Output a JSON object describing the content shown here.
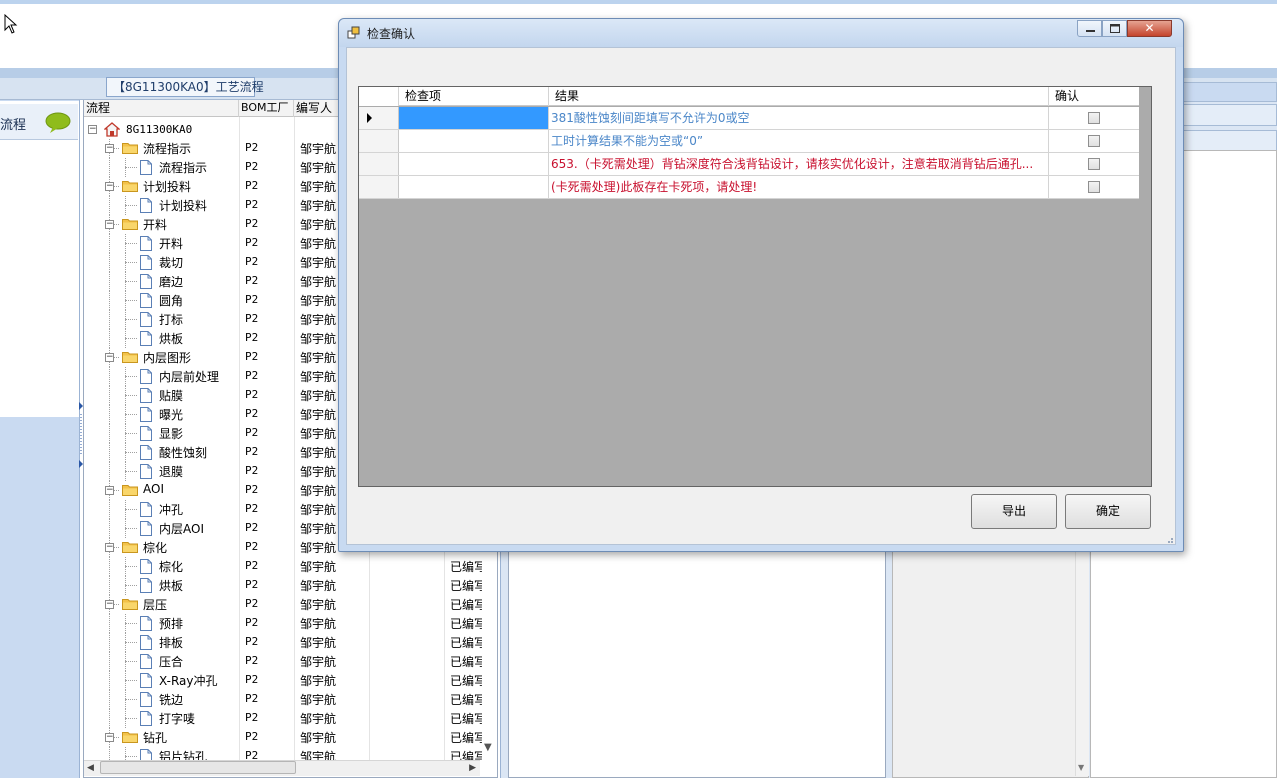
{
  "background_app": {
    "process_tab_label": "【8G11300KA0】工艺流程",
    "left_nav": {
      "item_label": "流程",
      "icon": "speech-bubble-icon"
    },
    "tree_grid": {
      "columns": [
        "流程",
        "BOM工厂",
        "编写人"
      ],
      "root_label": "8G11300KA0",
      "rows": [
        {
          "level": 1,
          "type": "folder",
          "label": "流程指示",
          "bom": "P2",
          "author": "邹宇航",
          "status": ""
        },
        {
          "level": 2,
          "type": "doc",
          "label": "流程指示",
          "bom": "P2",
          "author": "邹宇航",
          "status": ""
        },
        {
          "level": 1,
          "type": "folder",
          "label": "计划投料",
          "bom": "P2",
          "author": "邹宇航",
          "status": ""
        },
        {
          "level": 2,
          "type": "doc",
          "label": "计划投料",
          "bom": "P2",
          "author": "邹宇航",
          "status": ""
        },
        {
          "level": 1,
          "type": "folder",
          "label": "开料",
          "bom": "P2",
          "author": "邹宇航",
          "status": ""
        },
        {
          "level": 2,
          "type": "doc",
          "label": "开料",
          "bom": "P2",
          "author": "邹宇航",
          "status": ""
        },
        {
          "level": 2,
          "type": "doc",
          "label": "裁切",
          "bom": "P2",
          "author": "邹宇航",
          "status": ""
        },
        {
          "level": 2,
          "type": "doc",
          "label": "磨边",
          "bom": "P2",
          "author": "邹宇航",
          "status": ""
        },
        {
          "level": 2,
          "type": "doc",
          "label": "圆角",
          "bom": "P2",
          "author": "邹宇航",
          "status": ""
        },
        {
          "level": 2,
          "type": "doc",
          "label": "打标",
          "bom": "P2",
          "author": "邹宇航",
          "status": ""
        },
        {
          "level": 2,
          "type": "doc",
          "label": "烘板",
          "bom": "P2",
          "author": "邹宇航",
          "status": ""
        },
        {
          "level": 1,
          "type": "folder",
          "label": "内层图形",
          "bom": "P2",
          "author": "邹宇航",
          "status": ""
        },
        {
          "level": 2,
          "type": "doc",
          "label": "内层前处理",
          "bom": "P2",
          "author": "邹宇航",
          "status": ""
        },
        {
          "level": 2,
          "type": "doc",
          "label": "贴膜",
          "bom": "P2",
          "author": "邹宇航",
          "status": ""
        },
        {
          "level": 2,
          "type": "doc",
          "label": "曝光",
          "bom": "P2",
          "author": "邹宇航",
          "status": ""
        },
        {
          "level": 2,
          "type": "doc",
          "label": "显影",
          "bom": "P2",
          "author": "邹宇航",
          "status": ""
        },
        {
          "level": 2,
          "type": "doc",
          "label": "酸性蚀刻",
          "bom": "P2",
          "author": "邹宇航",
          "status": ""
        },
        {
          "level": 2,
          "type": "doc",
          "label": "退膜",
          "bom": "P2",
          "author": "邹宇航",
          "status": ""
        },
        {
          "level": 1,
          "type": "folder",
          "label": "AOI",
          "bom": "P2",
          "author": "邹宇航",
          "status": ""
        },
        {
          "level": 2,
          "type": "doc",
          "label": "冲孔",
          "bom": "P2",
          "author": "邹宇航",
          "status": ""
        },
        {
          "level": 2,
          "type": "doc",
          "label": "内层AOI",
          "bom": "P2",
          "author": "邹宇航",
          "status": ""
        },
        {
          "level": 1,
          "type": "folder",
          "label": "棕化",
          "bom": "P2",
          "author": "邹宇航",
          "status": ""
        },
        {
          "level": 2,
          "type": "doc",
          "label": "棕化",
          "bom": "P2",
          "author": "邹宇航",
          "status": "已编写"
        },
        {
          "level": 2,
          "type": "doc",
          "label": "烘板",
          "bom": "P2",
          "author": "邹宇航",
          "status": "已编写"
        },
        {
          "level": 1,
          "type": "folder",
          "label": "层压",
          "bom": "P2",
          "author": "邹宇航",
          "status": "已编写"
        },
        {
          "level": 2,
          "type": "doc",
          "label": "预排",
          "bom": "P2",
          "author": "邹宇航",
          "status": "已编写"
        },
        {
          "level": 2,
          "type": "doc",
          "label": "排板",
          "bom": "P2",
          "author": "邹宇航",
          "status": "已编写"
        },
        {
          "level": 2,
          "type": "doc",
          "label": "压合",
          "bom": "P2",
          "author": "邹宇航",
          "status": "已编写"
        },
        {
          "level": 2,
          "type": "doc",
          "label": "X-Ray冲孔",
          "bom": "P2",
          "author": "邹宇航",
          "status": "已编写"
        },
        {
          "level": 2,
          "type": "doc",
          "label": "铣边",
          "bom": "P2",
          "author": "邹宇航",
          "status": "已编写"
        },
        {
          "level": 2,
          "type": "doc",
          "label": "打字唛",
          "bom": "P2",
          "author": "邹宇航",
          "status": "已编写"
        },
        {
          "level": 1,
          "type": "folder",
          "label": "钻孔",
          "bom": "P2",
          "author": "邹宇航",
          "status": "已编写"
        },
        {
          "level": 2,
          "type": "doc",
          "label": "铝片钻孔",
          "bom": "P2",
          "author": "邹宇航",
          "status": "已编写"
        }
      ]
    }
  },
  "dialog": {
    "title": "检查确认",
    "close_glyph": "✕",
    "grid": {
      "columns": {
        "item": "检查项",
        "result": "结果",
        "confirm": "确认"
      },
      "rows": [
        {
          "item": "",
          "result": "381酸性蚀刻间距填写不允许为0或空",
          "result_color": "#4a86c8",
          "confirmed": false,
          "current": true
        },
        {
          "item": "",
          "result": "工时计算结果不能为空或“0”",
          "result_color": "#4a86c8",
          "confirmed": false,
          "current": false
        },
        {
          "item": "",
          "result": "653.（卡死需处理）背钻深度符合浅背钻设计，请核实优化设计，注意若取消背钻后通孔...",
          "result_color": "#c8102e",
          "confirmed": false,
          "current": false
        },
        {
          "item": "",
          "result": "(卡死需处理)此板存在卡死项，请处理!",
          "result_color": "#c8102e",
          "confirmed": false,
          "current": false
        }
      ]
    },
    "buttons": {
      "export": "导出",
      "ok": "确定"
    }
  },
  "colors": {
    "selection": "#3399ff",
    "info_text": "#4a86c8",
    "error_text": "#c8102e",
    "grid_empty_bg": "#ababab"
  }
}
